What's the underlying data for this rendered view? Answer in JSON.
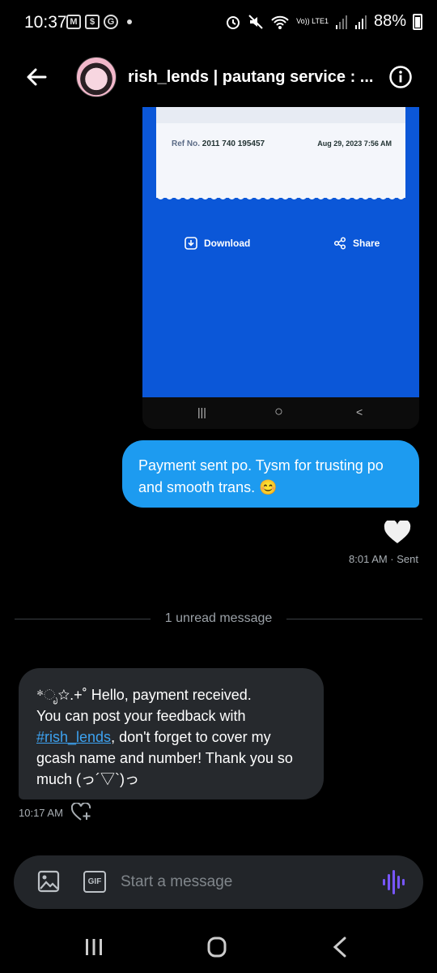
{
  "status_bar": {
    "time": "10:37",
    "battery": "88%",
    "network": "Vo)) LTE1",
    "left_icons": [
      "gmail-icon",
      "shop-icon",
      "google-icon",
      "dot-icon"
    ],
    "right_icons": [
      "alarm-icon",
      "mute-icon",
      "wifi-icon",
      "signal-icon",
      "signal-icon",
      "battery-icon"
    ]
  },
  "header": {
    "title": "rish_lends | pautang service : ...",
    "back_icon": "back-arrow-icon",
    "info_icon": "info-icon"
  },
  "shared_image": {
    "ref_label": "Ref No.",
    "ref_number": "2011 740 195457",
    "date": "Aug 29, 2023 7:56 AM",
    "download_label": "Download",
    "share_label": "Share",
    "nav_recent": "|||",
    "nav_home": "○",
    "nav_back": "<"
  },
  "messages": {
    "sent": {
      "text": "Payment sent po. Tysm for trusting po and smooth trans. 😊",
      "reaction": "🤍",
      "meta": "8:01 AM · Sent"
    },
    "divider": "1 unread message",
    "received": {
      "line1": "*ೃ☆.+˚ Hello, payment received.",
      "line2_prefix": "You can post your feedback with ",
      "hashtag": "#rish_lends",
      "line2_suffix": ", don't forget to cover my gcash name and number! Thank you so much (っ´▽`)っ",
      "time": "10:17 AM"
    }
  },
  "composer": {
    "placeholder": "Start a message",
    "gif_label": "GIF"
  },
  "colors": {
    "sent_bubble": "#1d9bf0",
    "received_bubble": "#26292d",
    "gcash_blue": "#0b57d8",
    "voice_accent": "#7856ff"
  }
}
